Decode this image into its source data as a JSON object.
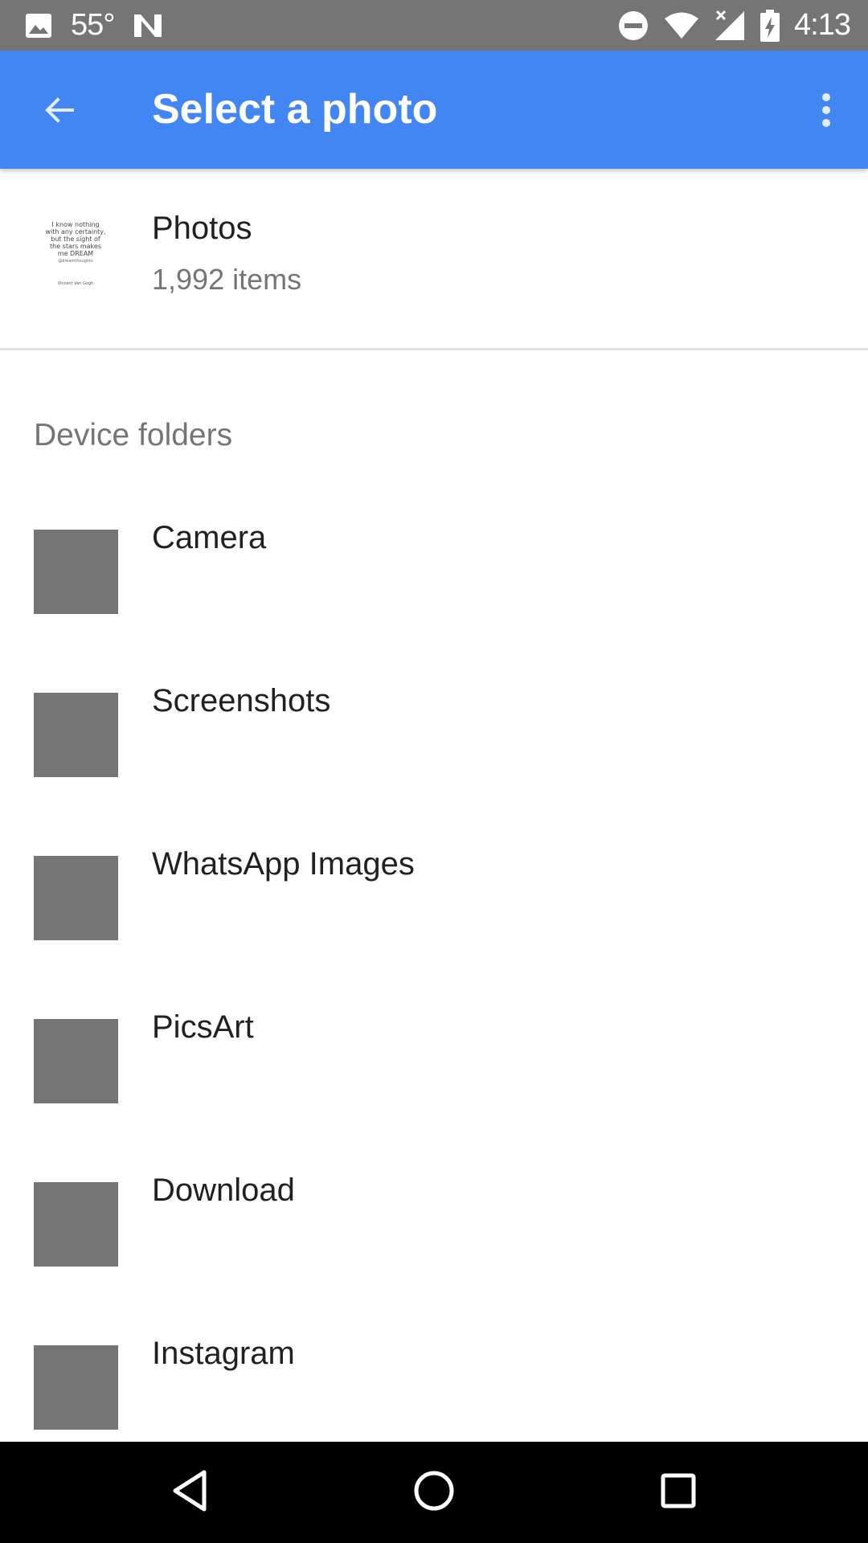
{
  "status_bar": {
    "temperature": "55°",
    "time": "4:13",
    "icons": [
      "image-icon",
      "nfc-n-icon",
      "do-not-disturb-icon",
      "wifi-icon",
      "signal-icon",
      "battery-charging-icon"
    ]
  },
  "app_bar": {
    "title": "Select a photo",
    "background_color": "#4286f4",
    "back_icon": "arrow-back-icon",
    "menu_icon": "more-vert-icon"
  },
  "photos": {
    "title": "Photos",
    "count": "1,992 items",
    "thumbnail_text": {
      "lines": [
        "I know nothing",
        "with any certainty,",
        "but the sight of",
        "the stars makes",
        "me DREAM"
      ],
      "signature": "@dreamthoughts",
      "author": "Vincent Van Gogh"
    }
  },
  "device_folders": {
    "header": "Device folders",
    "items": [
      {
        "label": "Camera"
      },
      {
        "label": "Screenshots"
      },
      {
        "label": "WhatsApp Images"
      },
      {
        "label": "PicsArt"
      },
      {
        "label": "Download"
      },
      {
        "label": "Instagram"
      }
    ]
  },
  "nav_bar": {
    "icons": [
      "back-triangle-icon",
      "home-circle-icon",
      "recents-square-icon"
    ]
  }
}
